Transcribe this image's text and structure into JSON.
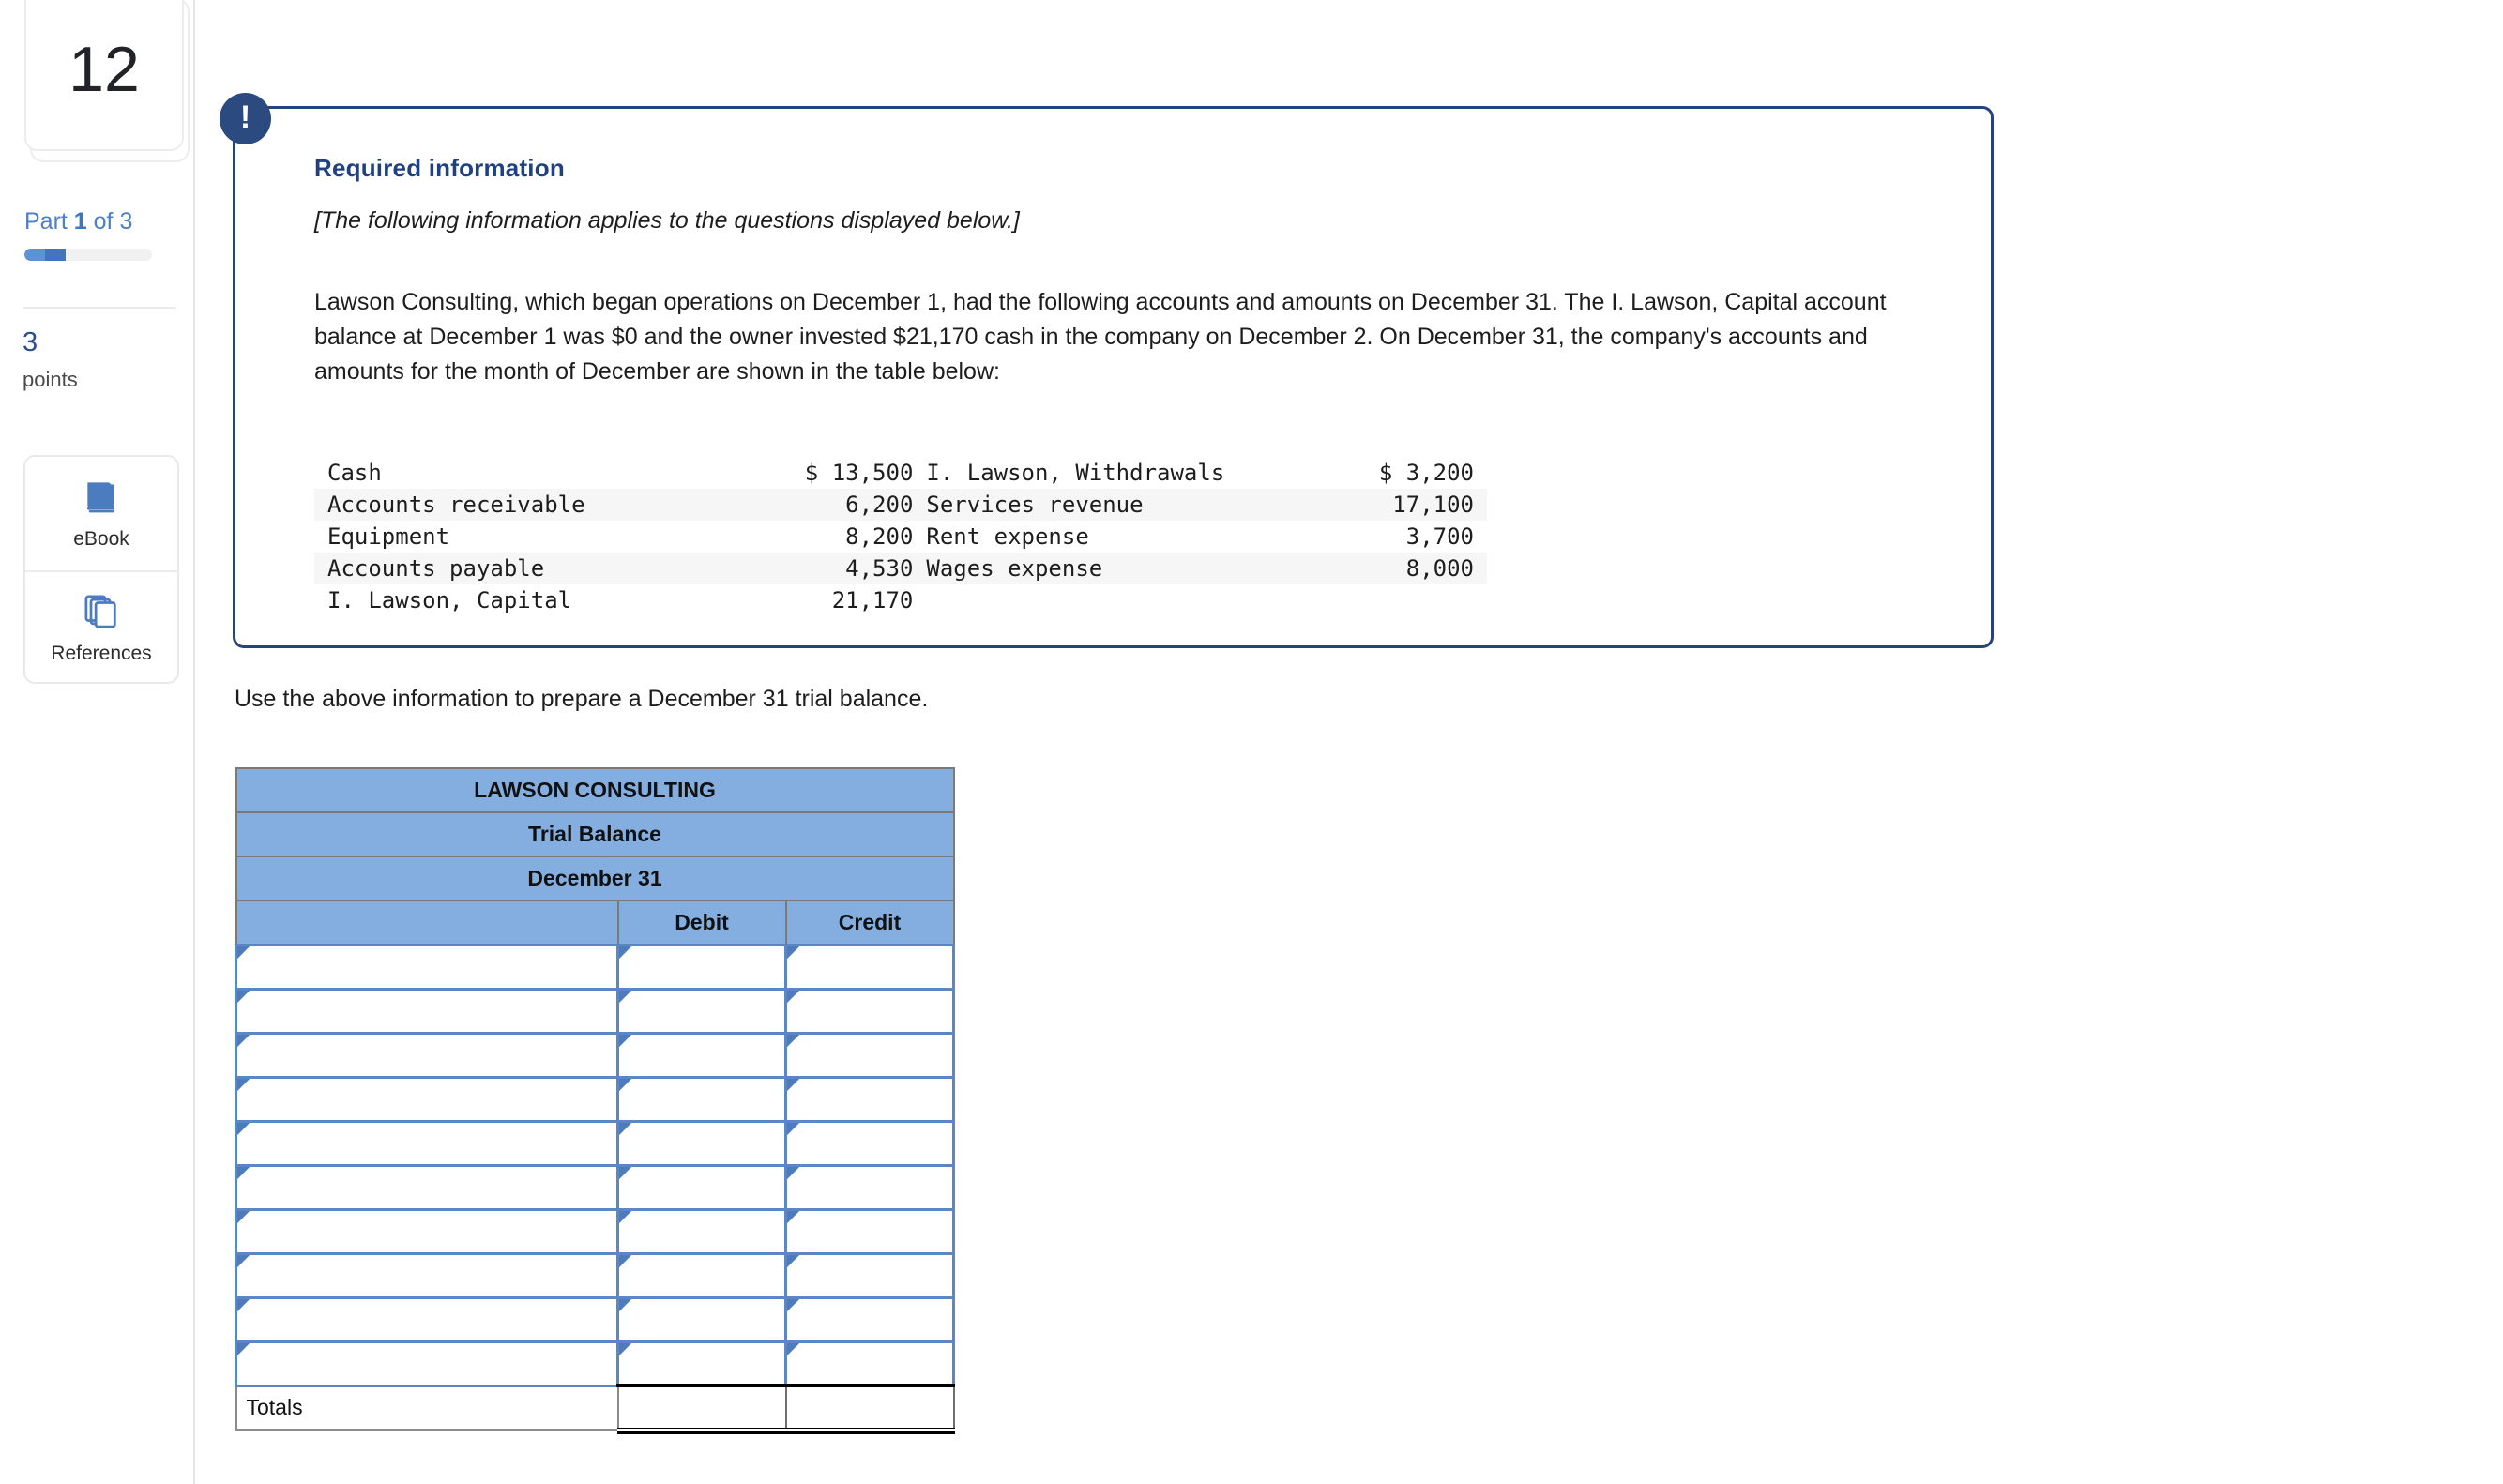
{
  "sidebar": {
    "question_number": "12",
    "part_prefix": "Part ",
    "part_current": "1",
    "part_suffix": " of 3",
    "points_value": "3",
    "points_word": "points",
    "tools": [
      {
        "icon": "ebook-icon",
        "label": "eBook"
      },
      {
        "icon": "references-icon",
        "label": "References"
      }
    ],
    "progress_percent": 33
  },
  "callout": {
    "badge_glyph": "!",
    "title": "Required information",
    "italic_note": "[The following information applies to the questions displayed below.]",
    "paragraph": "Lawson Consulting, which began operations on December 1, had the following accounts and amounts on December 31. The I. Lawson, Capital account balance at December 1 was $0 and the owner invested $21,170 cash in the company on December 2. On December 31, the company's accounts and amounts for the month of December are shown in the table below:",
    "accounts_table": {
      "rows": [
        {
          "left_name": "Cash",
          "left_amount": "$ 13,500",
          "right_name": "I. Lawson, Withdrawals",
          "right_amount": "$ 3,200"
        },
        {
          "left_name": "Accounts receivable",
          "left_amount": "6,200",
          "right_name": "Services revenue",
          "right_amount": "17,100"
        },
        {
          "left_name": "Equipment",
          "left_amount": "8,200",
          "right_name": "Rent expense",
          "right_amount": "3,700"
        },
        {
          "left_name": "Accounts payable",
          "left_amount": "4,530",
          "right_name": "Wages expense",
          "right_amount": "8,000"
        },
        {
          "left_name": "I. Lawson, Capital",
          "left_amount": "21,170",
          "right_name": "",
          "right_amount": ""
        }
      ]
    }
  },
  "prompt": "Use the above information to prepare a December 31 trial balance.",
  "trial_balance": {
    "title_line_1": "LAWSON CONSULTING",
    "title_line_2": "Trial Balance",
    "title_line_3": "December 31",
    "columns": {
      "account": "",
      "debit": "Debit",
      "credit": "Credit"
    },
    "entry_rows": [
      {
        "account": "",
        "debit": "",
        "credit": ""
      },
      {
        "account": "",
        "debit": "",
        "credit": ""
      },
      {
        "account": "",
        "debit": "",
        "credit": ""
      },
      {
        "account": "",
        "debit": "",
        "credit": ""
      },
      {
        "account": "",
        "debit": "",
        "credit": ""
      },
      {
        "account": "",
        "debit": "",
        "credit": ""
      },
      {
        "account": "",
        "debit": "",
        "credit": ""
      },
      {
        "account": "",
        "debit": "",
        "credit": ""
      },
      {
        "account": "",
        "debit": "",
        "credit": ""
      },
      {
        "account": "",
        "debit": "",
        "credit": ""
      }
    ],
    "totals_label": "Totals",
    "totals_debit": "",
    "totals_credit": ""
  },
  "colors": {
    "header_blue": "#85aee0",
    "callout_border": "#27427d",
    "badge_navy": "#2a4a80",
    "title_blue": "#1f4182",
    "input_border": "#5b87c4",
    "accent_link": "#4d7fc6"
  }
}
